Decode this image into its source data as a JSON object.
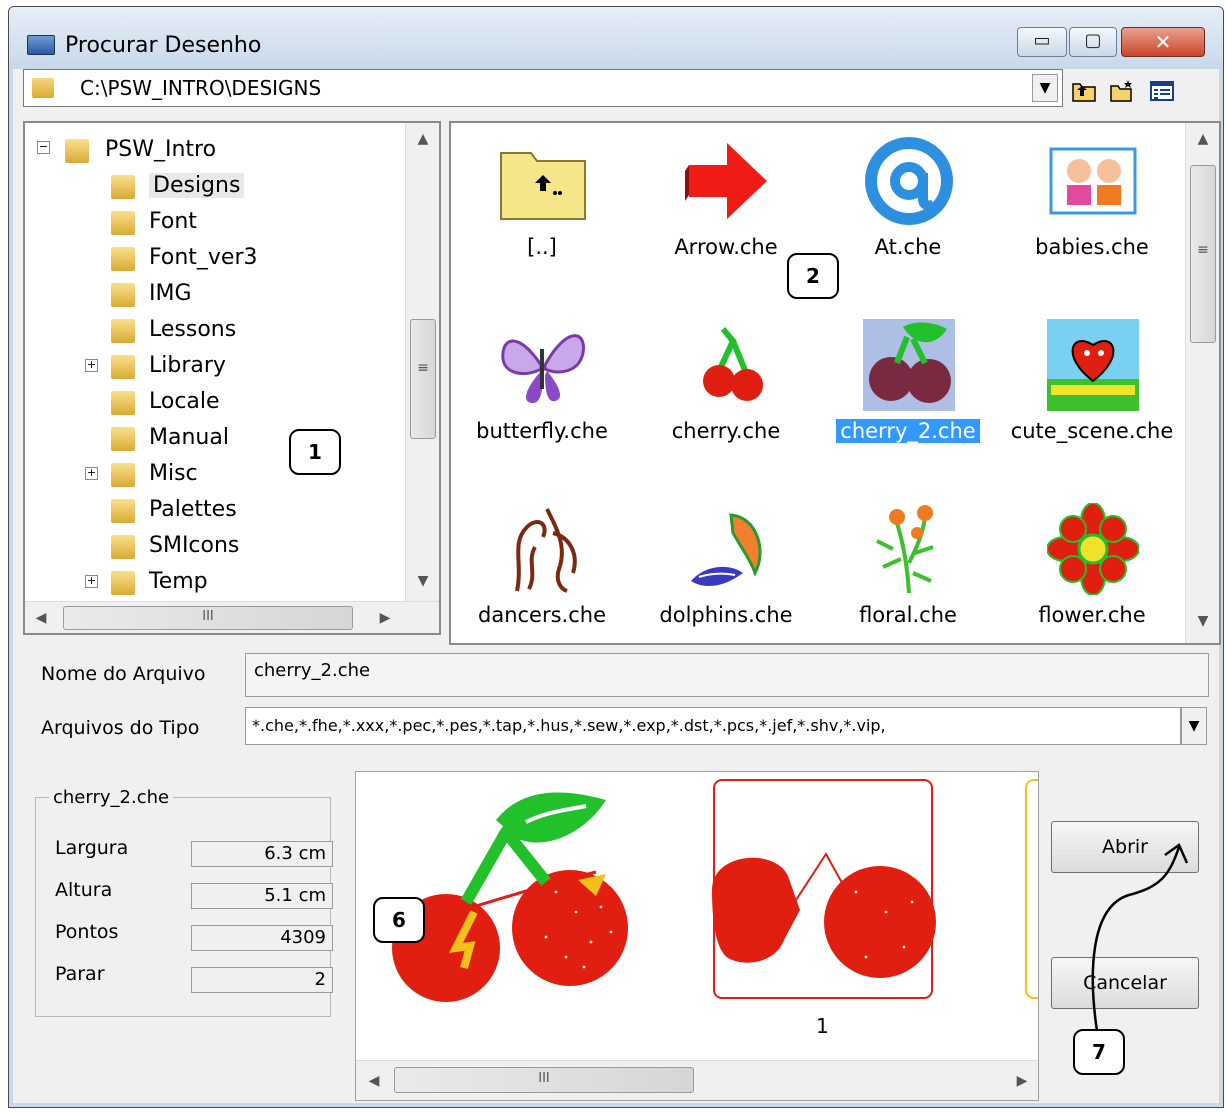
{
  "window": {
    "title": "Procurar Desenho",
    "controls": {
      "minimize": "▭",
      "maximize": "▢",
      "close": "✕"
    }
  },
  "pathbar": {
    "path": "C:\\PSW_INTRO\\DESIGNS",
    "icons": [
      "up-folder-icon",
      "new-folder-icon",
      "view-menu-icon"
    ]
  },
  "tree": {
    "root": "PSW_Intro",
    "items": [
      {
        "label": "Designs",
        "selected": true,
        "expandable": false
      },
      {
        "label": "Font",
        "expandable": false
      },
      {
        "label": "Font_ver3",
        "expandable": false
      },
      {
        "label": "IMG",
        "expandable": false
      },
      {
        "label": "Lessons",
        "expandable": false
      },
      {
        "label": "Library",
        "expandable": true
      },
      {
        "label": "Locale",
        "expandable": false
      },
      {
        "label": "Manual",
        "expandable": false
      },
      {
        "label": "Misc",
        "expandable": true
      },
      {
        "label": "Palettes",
        "expandable": false
      },
      {
        "label": "SMIcons",
        "expandable": false
      },
      {
        "label": "Temp",
        "expandable": true
      }
    ],
    "scroll_thumb_label": "≡",
    "hscroll_thumb_label": "III"
  },
  "files": {
    "items": [
      "[..]",
      "Arrow.che",
      "At.che",
      "babies.che",
      "butterfly.che",
      "cherry.che",
      "cherry_2.che",
      "cute_scene.che",
      "dancers.che",
      "dolphins.che",
      "floral.che",
      "flower.che"
    ],
    "selected": "cherry_2.che",
    "scroll_thumb_label": "≡"
  },
  "form": {
    "filename_label": "Nome do Arquivo",
    "filename_value": "cherry_2.che",
    "filetype_label": "Arquivos do Tipo",
    "filetype_value": "*.che,*.fhe,*.xxx,*.pec,*.pes,*.tap,*.hus,*.sew,*.exp,*.dst,*.pcs,*.jef,*.shv,*.vip,"
  },
  "info": {
    "title": "cherry_2.che",
    "rows": [
      {
        "label": "Largura",
        "value": "6.3 cm"
      },
      {
        "label": "Altura",
        "value": "5.1 cm"
      },
      {
        "label": "Pontos",
        "value": "4309"
      },
      {
        "label": "Parar",
        "value": "2"
      }
    ]
  },
  "preview": {
    "stop_number": "1",
    "hscroll_thumb_label": "III"
  },
  "buttons": {
    "open": "Abrir",
    "cancel": "Cancelar"
  },
  "callouts": {
    "c1": "1",
    "c2": "2",
    "c6": "6",
    "c7": "7"
  },
  "colors": {
    "selection": "#3399ff",
    "cherry_red": "#e01f10",
    "leaf_green": "#22c02a",
    "accent_yellow": "#f2c21a"
  }
}
